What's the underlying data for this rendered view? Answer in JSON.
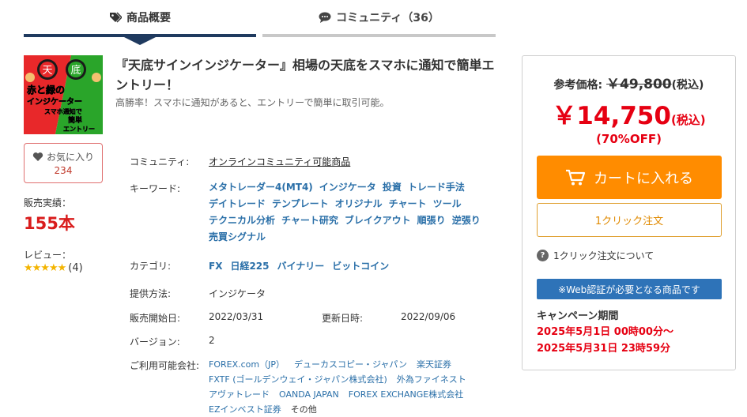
{
  "tabs": {
    "overview": "商品概要",
    "community": "コミュニティ（36）"
  },
  "product": {
    "image": {
      "badge_left": "天",
      "badge_right": "底",
      "line1": "赤と緑の",
      "line2": "インジケーター",
      "line3": "スマホ通知で",
      "line4": "簡単",
      "line5": "エントリー",
      "colors": {
        "red": "#e8282a",
        "green": "#2aa52a"
      }
    },
    "title": "『天底サインインジケーター』相場の天底をスマホに通知で簡単エントリー！",
    "subtitle": "高勝率！スマホに通知があると、エントリーで簡単に取引可能。"
  },
  "favorite": {
    "label": "お気に入り",
    "count": "234"
  },
  "sales": {
    "label": "販売実績：",
    "value": "155本"
  },
  "review": {
    "label": "レビュー：",
    "stars": "★★★★★",
    "count": "(4)"
  },
  "info": {
    "community_label": "コミュニティ:",
    "community_value": "オンラインコミュニティ可能商品",
    "keywords_label": "キーワード:",
    "keywords": [
      "メタトレーダー4(MT4)",
      "インジケータ",
      "投資",
      "トレード手法",
      "デイトレード",
      "テンプレート",
      "オリジナル",
      "チャート",
      "ツール",
      "テクニカル分析",
      "チャート研究",
      "ブレイクアウト",
      "順張り",
      "逆張り",
      "売買シグナル"
    ],
    "category_label": "カテゴリ:",
    "categories": [
      "FX",
      "日経225",
      "バイナリー",
      "ビットコイン"
    ],
    "method_label": "提供方法:",
    "method_value": "インジケータ",
    "start_label": "販売開始日:",
    "start_value": "2022/03/31",
    "update_label": "更新日時:",
    "update_value": "2022/09/06",
    "version_label": "バージョン:",
    "version_value": "2",
    "brokers_label": "ご利用可能会社:",
    "brokers": [
      "FOREX.com（JP）",
      "デューカスコピー・ジャパン",
      "楽天証券",
      "FXTF (ゴールデンウェイ・ジャパン株式会社)",
      "外為ファイネスト",
      "アヴァトレード",
      "OANDA JAPAN",
      "FOREX EXCHANGE株式会社",
      "EZインベスト証券"
    ],
    "brokers_other": "その他"
  },
  "purchase": {
    "ref_label": "参考価格:",
    "ref_price": "￥49,800",
    "ref_tax": "(税込)",
    "price": "￥14,750",
    "price_tax": "(税込)",
    "discount": "(70%OFF)",
    "cart_label": "カートに入れる",
    "oneclick_label": "1クリック注文",
    "oneclick_help": "1クリック注文について",
    "web_auth": "※Web認証が必要となる商品です",
    "campaign_label": "キャンペーン期間",
    "campaign_start": "2025年5月1日 00時00分～",
    "campaign_end": "2025年5月31日 23時59分",
    "colors": {
      "orange": "#ff8c00",
      "red": "#e60012",
      "blue": "#2e73b8"
    }
  }
}
